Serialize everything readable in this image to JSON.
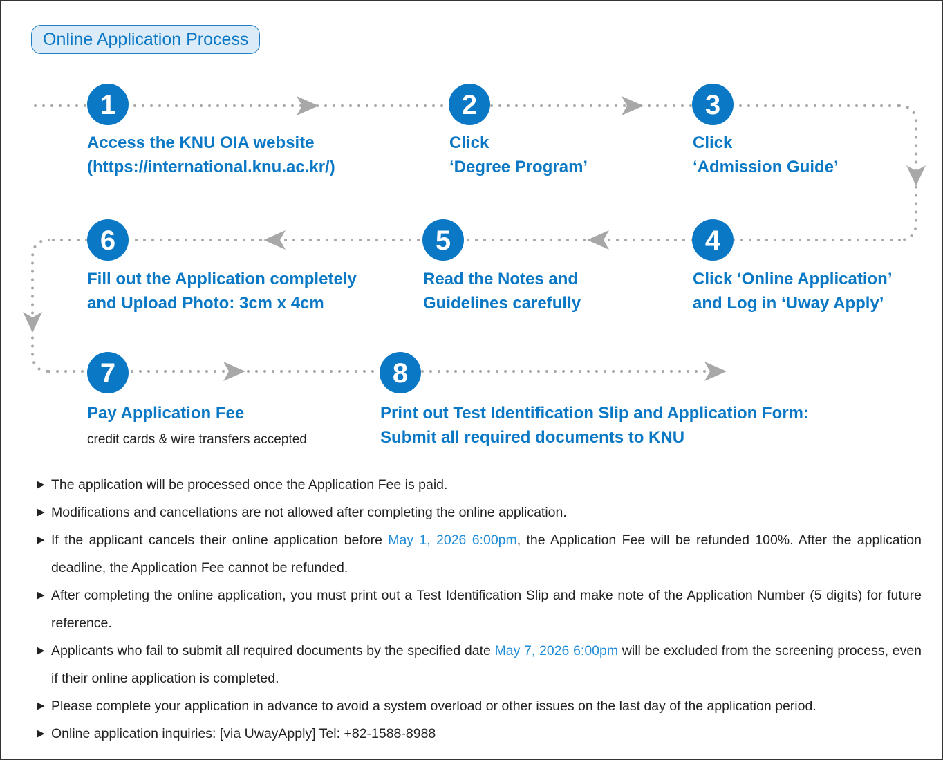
{
  "header": {
    "title": "Online Application Process"
  },
  "steps": [
    {
      "number": "1",
      "lines": [
        "Access the KNU OIA website",
        "(https://international.knu.ac.kr/)"
      ]
    },
    {
      "number": "2",
      "lines": [
        "Click",
        "‘Degree Program’"
      ]
    },
    {
      "number": "3",
      "lines": [
        "Click",
        "‘Admission Guide’"
      ]
    },
    {
      "number": "4",
      "lines": [
        "Click ‘Online Application’",
        "and Log in ‘Uway Apply’"
      ]
    },
    {
      "number": "5",
      "lines": [
        "Read the Notes and",
        "Guidelines carefully"
      ]
    },
    {
      "number": "6",
      "lines": [
        "Fill out the Application completely",
        "and Upload Photo: 3cm x 4cm"
      ]
    },
    {
      "number": "7",
      "lines": [
        "Pay Application Fee"
      ],
      "sub": "credit cards & wire transfers accepted"
    },
    {
      "number": "8",
      "lines": [
        "Print out Test Identification Slip and Application Form:",
        "Submit all required documents to KNU"
      ]
    }
  ],
  "notes": {
    "bullet": "▶",
    "n1": "The application will be processed once the Application Fee is paid.",
    "n2": "Modifications and cancellations are not allowed after completing the online application.",
    "n3_pre": "If the applicant cancels their online application before ",
    "n3_date": "May 1, 2026 6:00pm",
    "n3_post": ", the Application Fee will be refunded 100%. After the application deadline, the Application Fee cannot be refunded.",
    "n4": "After completing the online application, you must print out a Test Identification Slip and make note of the Application Number (5 digits) for future reference.",
    "n5_pre": "Applicants who fail to submit all required documents by the specified date ",
    "n5_date": "May 7, 2026 6:00pm",
    "n5_post": " will be excluded from the screening process, even if their online application is completed.",
    "n6": "Please complete your application in advance to avoid a system overload or other issues on the last day of the application period.",
    "n7": "Online application inquiries: [via UwayApply] Tel: +82-1588-8988"
  },
  "colors": {
    "accent": "#0a78c5",
    "circle": "#0a78c5",
    "connector": "#a8a8a8",
    "highlight": "#1e8bd6"
  }
}
